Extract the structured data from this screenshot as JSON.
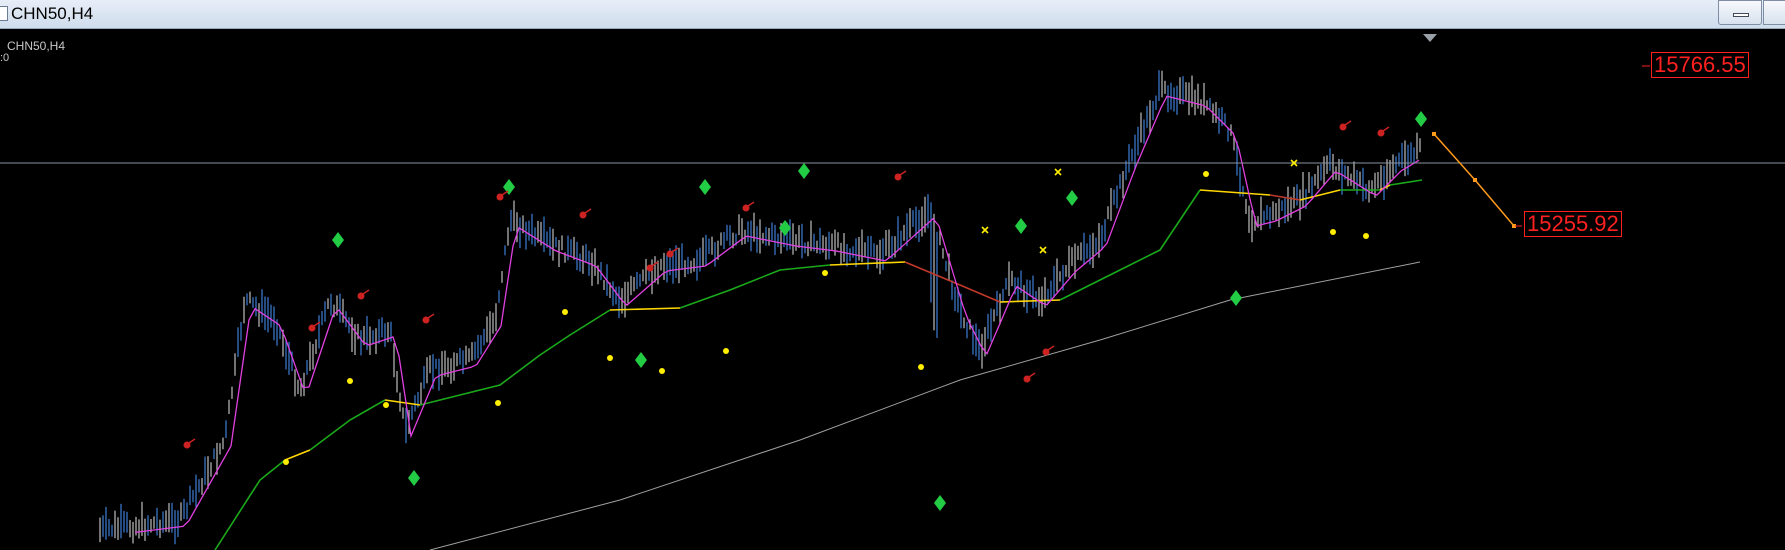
{
  "window": {
    "title": "CHN50,H4"
  },
  "chart": {
    "symbol_label": "CHN50,H4",
    "indicator_label": ":0",
    "price_high": "15766.55",
    "price_low": "15255.92"
  },
  "colors": {
    "background": "#000000",
    "bar_bull": "#3d7fd6",
    "bar_bear": "#bfbfbf",
    "fast_ma": "#e040e0",
    "mid_ma_up": "#1aaa1a",
    "mid_ma_flat": "#ffd700",
    "mid_ma_down": "#c0392b",
    "slow_ma": "#a0a0a0",
    "buy_signal": "#22cc44",
    "sell_signal": "#cc2222",
    "dot_signal": "#ffee00",
    "forecast_line": "#ff9a1a",
    "price_label": "#ff2020"
  },
  "icons": {
    "buy": "green-diamond-icon",
    "sell": "red-arrow-icon",
    "dot": "yellow-dot-icon",
    "cross": "yellow-cross-icon"
  }
}
